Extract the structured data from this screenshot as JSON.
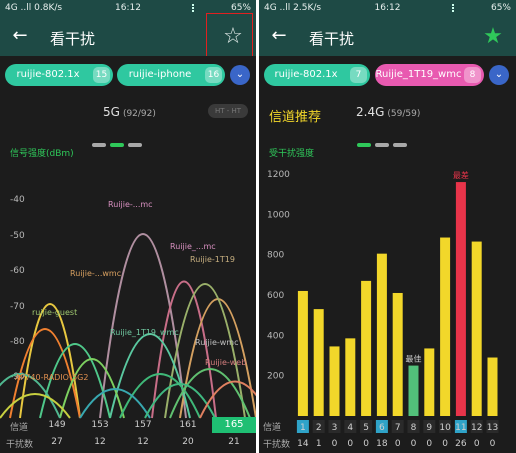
{
  "left": {
    "status": {
      "left": "4G ..ll 0.8K/s",
      "time": "16:12",
      "right": "65%"
    },
    "title": "看干扰",
    "chips": [
      {
        "label": "ruijie-802.1x",
        "count": "15",
        "color": "#2fc8a0"
      },
      {
        "label": "ruijie-iphone",
        "count": "16",
        "color": "#2fc8a0"
      }
    ],
    "band": {
      "label": "5G",
      "count": "(92/92)"
    },
    "mode_toggle": "HT - HT",
    "axis_title": "信号强度(dBm)",
    "y_ticks": [
      "-40",
      "-50",
      "-60",
      "-70",
      "-80",
      "-90"
    ],
    "footer": {
      "row1_label": "信道",
      "channels": [
        "149",
        "153",
        "157",
        "161",
        "165"
      ],
      "active_channel": "165",
      "row2_label": "干扰数",
      "counts": [
        "27",
        "12",
        "12",
        "20",
        "21"
      ]
    },
    "network_labels": [
      "Ruijie-...mc",
      "Ruijie_...mc",
      "Ruijie-1T19",
      "Ruijie-...wmc",
      "ruijie-guest",
      "Ruijie_1T19_wmc",
      "Ruijie-wmc",
      "AP740-RADIO-5G2",
      "Ruijie-web"
    ]
  },
  "right": {
    "status": {
      "left": "4G ..ll 2.5K/s",
      "time": "16:12",
      "right": "65%"
    },
    "title": "看干扰",
    "chips": [
      {
        "label": "ruijie-802.1x",
        "count": "7",
        "color": "#2fc8a0"
      },
      {
        "label": "Ruijie_1T19_wmc",
        "count": "8",
        "color": "#e85ab0"
      }
    ],
    "section_title": "信道推荐",
    "band": {
      "label": "2.4G",
      "count": "(59/59)"
    },
    "axis_title": "受干扰强度",
    "annotations": {
      "worst": "最差",
      "best": "最佳"
    },
    "footer": {
      "row1_label": "信道",
      "row2_label": "干扰数",
      "channels": [
        "1",
        "2",
        "3",
        "4",
        "5",
        "6",
        "7",
        "8",
        "9",
        "10",
        "11",
        "12",
        "13"
      ],
      "counts": [
        "14",
        "1",
        "0",
        "0",
        "0",
        "18",
        "0",
        "0",
        "0",
        "0",
        "26",
        "0",
        "0"
      ]
    }
  },
  "chart_data": [
    {
      "type": "bar",
      "title": "信道推荐",
      "ylabel": "受干扰强度",
      "categories": [
        "1",
        "2",
        "3",
        "4",
        "5",
        "6",
        "7",
        "8",
        "9",
        "10",
        "11",
        "12",
        "13"
      ],
      "values": [
        620,
        530,
        345,
        385,
        670,
        805,
        610,
        250,
        335,
        885,
        1160,
        865,
        290
      ],
      "ylim": [
        0,
        1200
      ],
      "y_ticks": [
        200,
        400,
        600,
        800,
        1000,
        1200
      ],
      "highlight": {
        "worst": "11",
        "best": "8"
      },
      "colors": {
        "normal": "#f2d72a",
        "worst": "#e8344a",
        "best": "#52c07a",
        "selected_tick": "#2fa3c8"
      },
      "grid": false
    }
  ]
}
